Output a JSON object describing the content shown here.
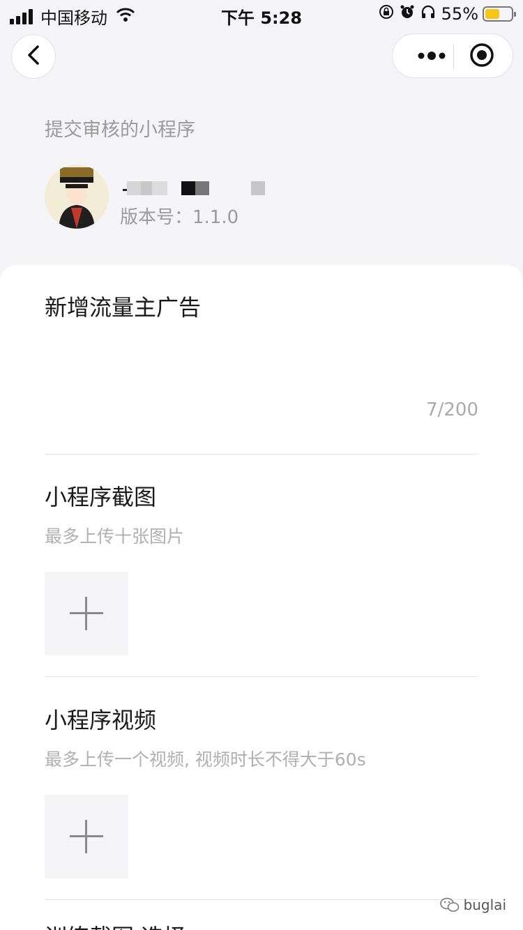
{
  "status_bar": {
    "carrier": "中国移动",
    "time": "下午 5:28",
    "battery": "55%",
    "battery_level": 0.55
  },
  "nav": {
    "back_icon": "chevron-left-icon",
    "more_icon": "more-dots-icon",
    "close_icon": "target-icon"
  },
  "header": {
    "submit_label": "提交审核的小程序",
    "version": "版本号：1.1.0"
  },
  "form": {
    "ad_text": "新增流量主广告",
    "counter": "7/200",
    "screenshot_title": "小程序截图",
    "screenshot_hint": "最多上传十张图片",
    "video_title": "小程序视频",
    "video_hint": "最多上传一个视频, 视频时长不得大于60s",
    "next_title_partial": "训练截图 选择"
  },
  "watermark": {
    "text": "buglai"
  },
  "colors": {
    "background": "#f5f5f7",
    "card": "#ffffff",
    "muted_text": "#9b9b9b",
    "battery_fill": "#f5c518"
  }
}
